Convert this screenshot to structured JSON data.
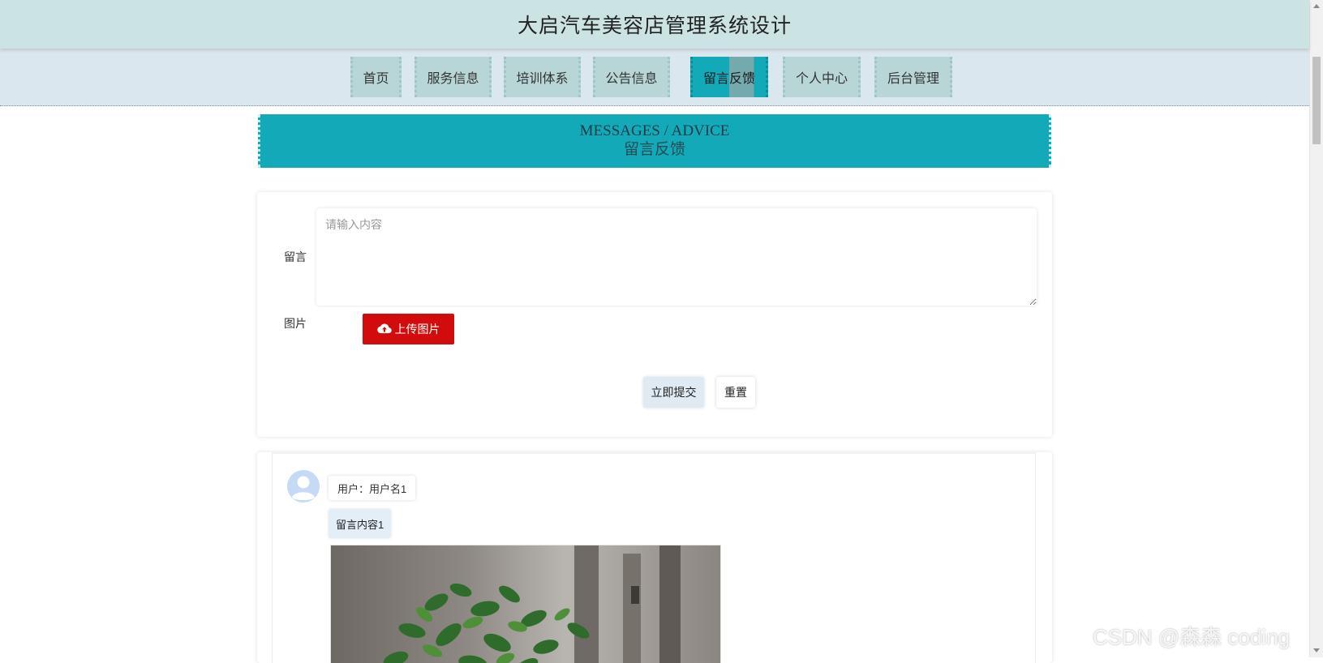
{
  "header": {
    "title": "大启汽车美容店管理系统设计"
  },
  "nav": {
    "items": [
      {
        "label": "首页"
      },
      {
        "label": "服务信息"
      },
      {
        "label": "培训体系"
      },
      {
        "label": "公告信息"
      },
      {
        "label": "留言反馈",
        "active": true
      },
      {
        "label": "个人中心"
      },
      {
        "label": "后台管理"
      }
    ]
  },
  "banner": {
    "title_en": "MESSAGES / ADVICE",
    "title_cn": "留言反馈"
  },
  "form": {
    "message_label": "留言",
    "message_placeholder": "请输入内容",
    "message_value": "",
    "image_label": "图片",
    "upload_label": "上传图片",
    "submit_label": "立即提交",
    "reset_label": "重置"
  },
  "messages": [
    {
      "user": "用户：用户名1",
      "content": "留言内容1"
    }
  ],
  "watermark": "CSDN @森森 coding",
  "colors": {
    "header_bg": "#cbe3e3",
    "nav_bg": "#dbe7ee",
    "nav_item_bg": "#b8d6d6",
    "accent_teal": "#12aab9",
    "upload_red": "#d20c0c",
    "submit_bg": "#dfeaf2"
  },
  "icons": {
    "upload": "cloud-upload-icon",
    "avatar": "user-avatar-icon"
  }
}
